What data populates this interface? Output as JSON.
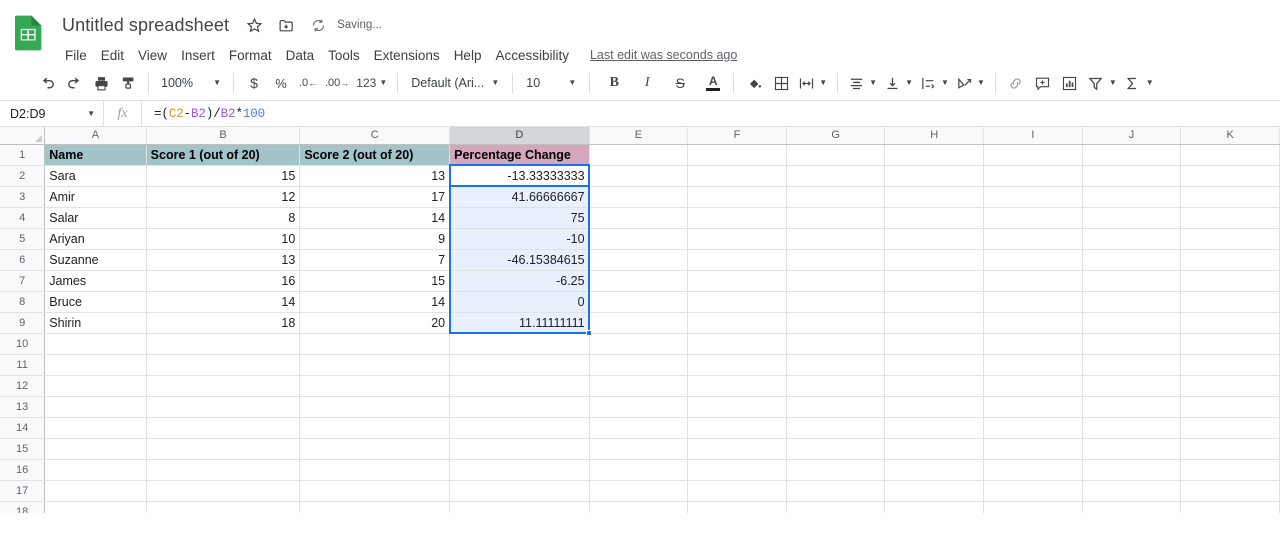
{
  "app": {
    "logo_icon": "sheets-logo-icon",
    "doc_title": "Untitled spreadsheet",
    "star_icon": "star-icon",
    "move_icon": "move-to-folder-icon",
    "sync_icon": "sync-cloud-icon",
    "save_status": "Saving...",
    "last_edit": "Last edit was seconds ago"
  },
  "menu": {
    "items": [
      {
        "label": "File"
      },
      {
        "label": "Edit"
      },
      {
        "label": "View"
      },
      {
        "label": "Insert"
      },
      {
        "label": "Format"
      },
      {
        "label": "Data"
      },
      {
        "label": "Tools"
      },
      {
        "label": "Extensions"
      },
      {
        "label": "Help"
      },
      {
        "label": "Accessibility"
      }
    ]
  },
  "toolbar": {
    "undo": "undo-icon",
    "redo": "redo-icon",
    "print": "print-icon",
    "paint_format": "paint-format-icon",
    "zoom_value": "100%",
    "currency": "$",
    "percent": "%",
    "decrease_decimal": ".0",
    "increase_decimal": ".00",
    "more_formats": "123",
    "font_family": "Default (Ari...",
    "font_size": "10",
    "bold": "B",
    "italic": "I",
    "strikethrough": "S",
    "text_color": "A",
    "fill_color": "fill-color-icon",
    "borders": "borders-icon",
    "merge_cells": "merge-cells-icon",
    "horizontal_align": "horizontal-align-icon",
    "vertical_align": "vertical-align-icon",
    "text_wrap": "text-wrap-icon",
    "text_rotation": "text-rotation-icon",
    "insert_link": "link-icon",
    "insert_comment": "comment-icon",
    "insert_chart": "chart-icon",
    "filter": "filter-icon",
    "functions": "sigma-functions-icon"
  },
  "formula_bar": {
    "name_box": "D2:D9",
    "fx_label": "fx",
    "formula_parts": [
      {
        "text": "=(",
        "kind": "plain"
      },
      {
        "text": "C2",
        "kind": "ref-c"
      },
      {
        "text": "-",
        "kind": "plain"
      },
      {
        "text": "B2",
        "kind": "ref-b"
      },
      {
        "text": ")/",
        "kind": "plain"
      },
      {
        "text": "B2",
        "kind": "ref-b"
      },
      {
        "text": "*",
        "kind": "plain"
      },
      {
        "text": "100",
        "kind": "num-lit"
      }
    ],
    "formula_plain": "=(C2-B2)/B2*100"
  },
  "grid": {
    "column_letters": [
      "A",
      "B",
      "C",
      "D",
      "E",
      "F",
      "G",
      "H",
      "I",
      "J",
      "K"
    ],
    "selected_column": "D",
    "row_numbers": [
      1,
      2,
      3,
      4,
      5,
      6,
      7,
      8,
      9,
      10,
      11,
      12,
      13,
      14,
      15,
      16,
      17,
      18
    ],
    "selection_range": "D2:D9",
    "active_cell": "D2",
    "headers": {
      "A": "Name",
      "B": "Score 1 (out of 20)",
      "C": "Score 2 (out of 20)",
      "D": "Percentage Change"
    },
    "header_colors": {
      "teal": "#a2c4c9",
      "pink": "#d5a6bd"
    },
    "selection_color": "#1a73e8",
    "selection_fill": "#e8f0fe",
    "rows": [
      {
        "row": 2,
        "name": "Sara",
        "score1": "15",
        "score2": "13",
        "pct": "-13.33333333"
      },
      {
        "row": 3,
        "name": "Amir",
        "score1": "12",
        "score2": "17",
        "pct": "41.66666667"
      },
      {
        "row": 4,
        "name": "Salar",
        "score1": "8",
        "score2": "14",
        "pct": "75"
      },
      {
        "row": 5,
        "name": "Ariyan",
        "score1": "10",
        "score2": "9",
        "pct": "-10"
      },
      {
        "row": 6,
        "name": "Suzanne",
        "score1": "13",
        "score2": "7",
        "pct": "-46.15384615"
      },
      {
        "row": 7,
        "name": "James",
        "score1": "16",
        "score2": "15",
        "pct": "-6.25"
      },
      {
        "row": 8,
        "name": "Bruce",
        "score1": "14",
        "score2": "14",
        "pct": "0"
      },
      {
        "row": 9,
        "name": "Shirin",
        "score1": "18",
        "score2": "20",
        "pct": "11.11111111"
      }
    ]
  }
}
